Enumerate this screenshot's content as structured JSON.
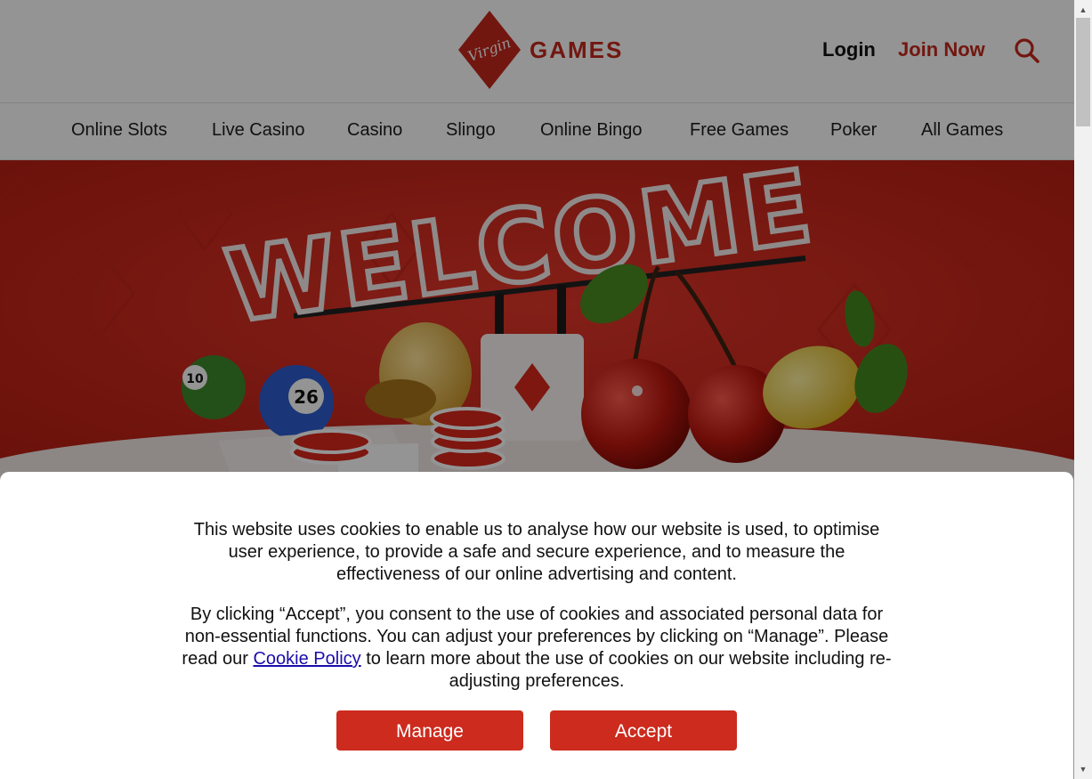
{
  "header": {
    "logo_script": "Virgin",
    "logo_text": "GAMES",
    "login": "Login",
    "join": "Join Now"
  },
  "nav": [
    "Online Slots",
    "Live Casino",
    "Casino",
    "Slingo",
    "Online Bingo",
    "Free Games",
    "Poker",
    "All Games"
  ],
  "hero": {
    "neon_text": "WELCOME",
    "ball_1": "10",
    "ball_2": "26"
  },
  "cookie": {
    "para1": "This website uses cookies to enable us to analyse how our website is used, to optimise user experience, to provide a safe and secure experience, and to measure the effectiveness of our online advertising and content.",
    "para2_before": "By clicking “Accept”, you consent to the use of cookies and associated personal data for non-essential functions. You can adjust your preferences by clicking on “Manage”. Please read our ",
    "para2_link": "Cookie Policy",
    "para2_after": " to learn more about the use of cookies on our website including re-adjusting preferences.",
    "manage": "Manage",
    "accept": "Accept"
  },
  "icons": {
    "search": "search-icon",
    "logo": "virgin-diamond-logo-icon"
  },
  "colors": {
    "brand_red": "#c5281c",
    "button_red": "#cc2b1e",
    "hero_red": "#d7291d",
    "link_blue": "#1a0dab"
  }
}
